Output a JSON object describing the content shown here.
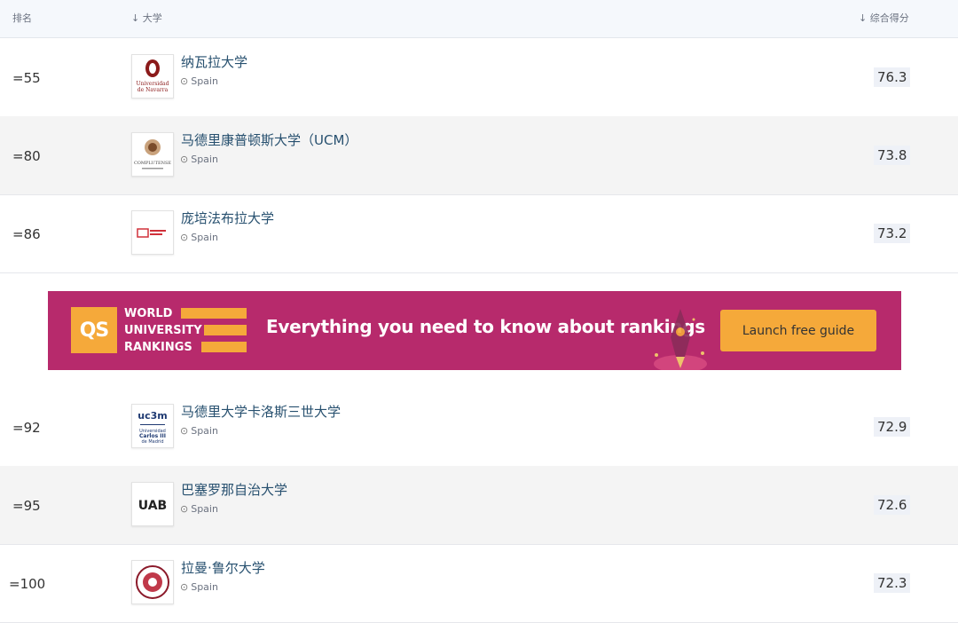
{
  "header": {
    "rank_label": "排名",
    "university_label": "↓ 大学",
    "score_label": "↓  综合得分"
  },
  "rows": [
    {
      "rank": "=55",
      "name": "纳瓦拉大学",
      "location": "Spain",
      "score": "76.3",
      "logo": "navarra-logo"
    },
    {
      "rank": "=80",
      "name": "马德里康普顿斯大学（UCM）",
      "location": "Spain",
      "score": "73.8",
      "logo": "complutense-logo"
    },
    {
      "rank": "=86",
      "name": "庞培法布拉大学",
      "location": "Spain",
      "score": "73.2",
      "logo": "pompeu-fabra-logo"
    },
    {
      "rank": "=92",
      "name": "马德里大学卡洛斯三世大学",
      "location": "Spain",
      "score": "72.9",
      "logo": "uc3m-logo"
    },
    {
      "rank": "=95",
      "name": "巴塞罗那自治大学",
      "location": "Spain",
      "score": "72.6",
      "logo": "uab-logo"
    },
    {
      "rank": "=100",
      "name": "拉曼·鲁尔大学",
      "location": "Spain",
      "score": "72.3",
      "logo": "ramon-llull-logo"
    }
  ],
  "banner": {
    "qs": "QS",
    "line1": "WORLD",
    "line2": "UNIVERSITY",
    "line3": "RANKINGS",
    "headline": "Everything you need to know about rankings",
    "cta": "Launch free guide",
    "colors": {
      "background": "#b72a6c",
      "accent": "#f5a93a"
    }
  },
  "logos": {
    "uc3m_top": "uc3m",
    "uc3m_bottom": "Universidad Carlos III de Madrid",
    "uab": "UAB",
    "navarra": "Universidad de Navarra"
  }
}
